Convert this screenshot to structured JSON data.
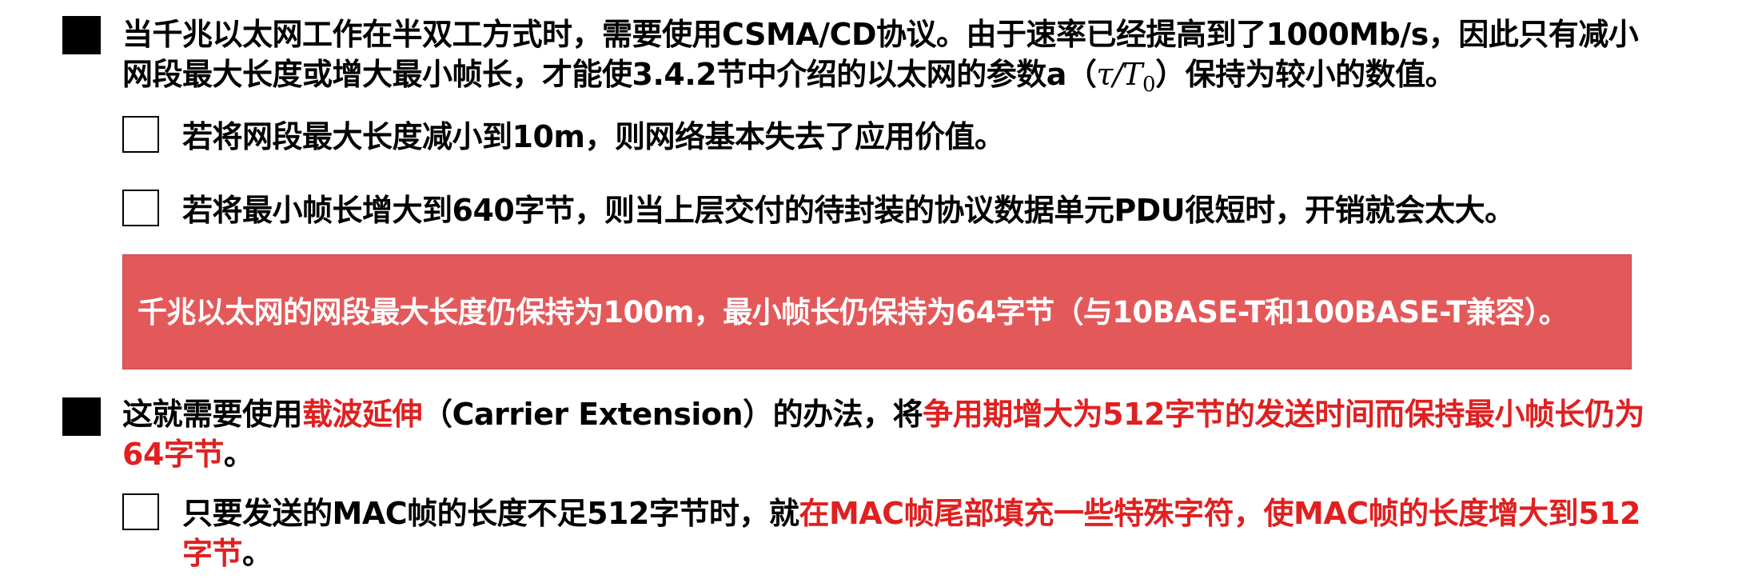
{
  "section1": {
    "line1": "当千兆以太网工作在半双工方式时，需要使用CSMA/CD协议。由于速率已经提高到了1000Mb/s，因此只有减小",
    "line2_prefix": "网段最大长度或增大最小帧长，才能使3.4.2节中介绍的以太网的参数a（",
    "line2_tau": "τ/T",
    "line2_sub": "0",
    "line2_suffix": "）保持为较小的数值。",
    "sub1": "若将网段最大长度减小到10m，则网络基本失去了应用价值。",
    "sub2": "若将最小帧长增大到640字节，则当上层交付的待封装的协议数据单元PDU很短时，开销就会太大。"
  },
  "highlight": {
    "text": "千兆以太网的网段最大长度仍保持为100m，最小帧长仍保持为64字节（与10BASE-T和100BASE-T兼容）。",
    "bg_color": "#e3595a"
  },
  "section2": {
    "p1_black": "这就需要使用",
    "p1_red": "载波延伸",
    "p1_black2": "（Carrier Extension）的办法，将",
    "p1_red2": "争用期增大为512字节的发送时间而保持最小帧长仍为",
    "p2_red": "64字节",
    "p2_black": "。",
    "sub1_black": "只要发送的MAC帧的长度不足512字节时，就",
    "sub1_red": "在MAC帧尾部填充一些特殊字符，使MAC帧的长度增大到512",
    "sub1_red2": "字节",
    "sub1_black2": "。"
  },
  "colors": {
    "accent_red": "#e02020",
    "text": "#000000"
  }
}
